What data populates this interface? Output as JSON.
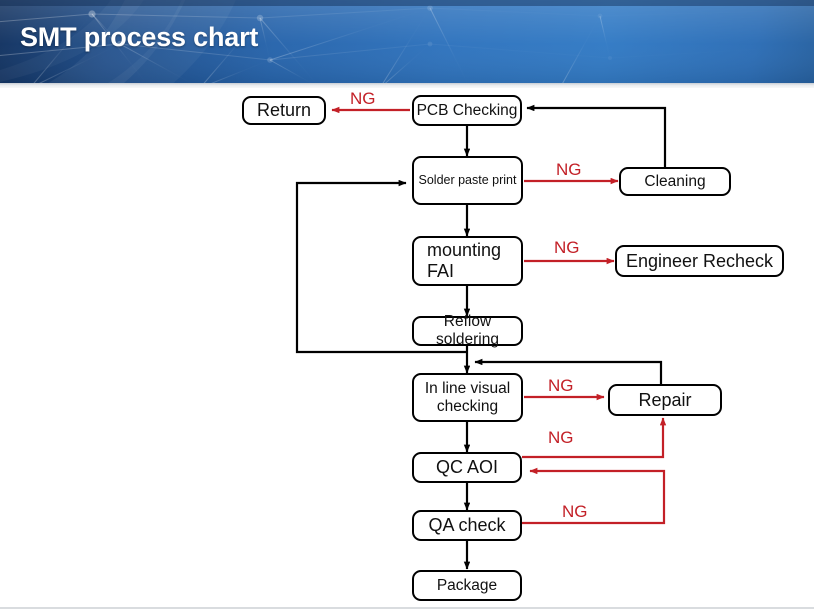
{
  "header": {
    "title": "SMT process chart",
    "bg_dark": "#10305e",
    "bg_light": "#3079c4"
  },
  "colors": {
    "flow_line": "#000000",
    "ng_line": "#c32027",
    "ng_text": "#c32027",
    "node_border": "#000000",
    "node_fill": "#ffffff"
  },
  "chart_data": {
    "type": "diagram",
    "title": "SMT process chart",
    "nodes": [
      {
        "id": "return",
        "label": "Return",
        "shape": "rounded-rect"
      },
      {
        "id": "pcb",
        "label": "PCB Checking",
        "shape": "rounded-rect"
      },
      {
        "id": "solder",
        "label": "Solder paste print",
        "shape": "rounded-rect"
      },
      {
        "id": "cleaning",
        "label": "Cleaning",
        "shape": "rounded-rect"
      },
      {
        "id": "mounting",
        "label": "mounting\nFAI",
        "shape": "rounded-rect"
      },
      {
        "id": "engineer",
        "label": "Engineer Recheck",
        "shape": "rounded-rect"
      },
      {
        "id": "reflow",
        "label": "Reflow soldering",
        "shape": "rounded-rect"
      },
      {
        "id": "inline",
        "label": "In line visual\nchecking",
        "shape": "rounded-rect"
      },
      {
        "id": "repair",
        "label": "Repair",
        "shape": "rounded-rect"
      },
      {
        "id": "qcaoi",
        "label": "QC AOI",
        "shape": "rounded-rect"
      },
      {
        "id": "qacheck",
        "label": "QA check",
        "shape": "rounded-rect"
      },
      {
        "id": "package",
        "label": "Package",
        "shape": "rounded-rect"
      }
    ],
    "edges": [
      {
        "from": "pcb",
        "to": "return",
        "label": "NG",
        "color": "#c32027"
      },
      {
        "from": "pcb",
        "to": "solder",
        "label": "",
        "color": "#000000"
      },
      {
        "from": "solder",
        "to": "cleaning",
        "label": "NG",
        "color": "#c32027"
      },
      {
        "from": "cleaning",
        "to": "pcb",
        "label": "",
        "color": "#000000"
      },
      {
        "from": "solder",
        "to": "mounting",
        "label": "",
        "color": "#000000"
      },
      {
        "from": "mounting",
        "to": "engineer",
        "label": "NG",
        "color": "#c32027"
      },
      {
        "from": "mounting",
        "to": "reflow",
        "label": "",
        "color": "#000000"
      },
      {
        "from": "reflow",
        "to": "solder",
        "label": "",
        "color": "#000000"
      },
      {
        "from": "reflow",
        "to": "inline",
        "label": "",
        "color": "#000000"
      },
      {
        "from": "inline",
        "to": "repair",
        "label": "NG",
        "color": "#c32027"
      },
      {
        "from": "repair",
        "to": "inline",
        "label": "",
        "color": "#000000"
      },
      {
        "from": "inline",
        "to": "qcaoi",
        "label": "",
        "color": "#000000"
      },
      {
        "from": "qcaoi",
        "to": "repair",
        "label": "NG",
        "color": "#c32027"
      },
      {
        "from": "qcaoi",
        "to": "qacheck",
        "label": "",
        "color": "#000000"
      },
      {
        "from": "qacheck",
        "to": "qcaoi",
        "label": "NG",
        "color": "#c32027"
      },
      {
        "from": "qacheck",
        "to": "package",
        "label": "",
        "color": "#000000"
      }
    ],
    "ng_labels": [
      "NG",
      "NG",
      "NG",
      "NG",
      "NG",
      "NG"
    ]
  },
  "nodes": {
    "return": "Return",
    "pcb": "PCB Checking",
    "solder": "Solder paste print",
    "cleaning": "Cleaning",
    "mounting": "mounting\nFAI",
    "engineer": "Engineer Recheck",
    "reflow": "Reflow soldering",
    "inline": "In line visual\nchecking",
    "repair": "Repair",
    "qcaoi": "QC AOI",
    "qacheck": "QA check",
    "package": "Package"
  },
  "ng": {
    "pcb_return": "NG",
    "solder_cleaning": "NG",
    "mounting_eng": "NG",
    "inline_repair": "NG",
    "qcaoi_repair": "NG",
    "qacheck_qcaoi": "NG"
  }
}
